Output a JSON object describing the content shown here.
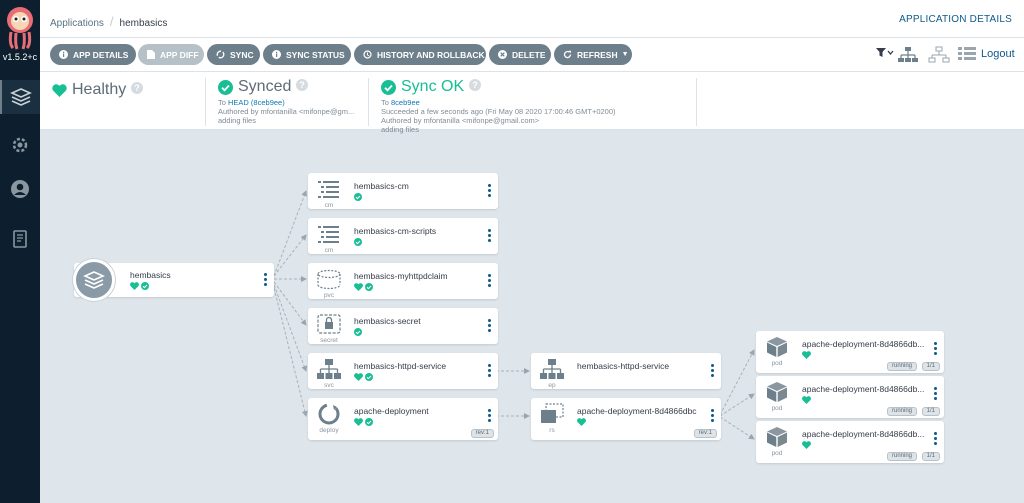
{
  "app": {
    "version": "v1.5.2+c"
  },
  "breadcrumb": {
    "parent": "Applications",
    "current": "hembasics"
  },
  "header": {
    "details_link": "APPLICATION DETAILS"
  },
  "toolbar": {
    "app_details": "APP DETAILS",
    "app_diff": "APP DIFF",
    "sync": "SYNC",
    "sync_status": "SYNC STATUS",
    "history": "HISTORY AND ROLLBACK",
    "delete": "DELETE",
    "refresh": "REFRESH",
    "logout": "Logout"
  },
  "status": {
    "health": {
      "label": "Healthy"
    },
    "sync": {
      "label": "Synced",
      "to_prefix": "To",
      "to": "HEAD (8ceb9ee)",
      "author": "Authored by mfontanilla <mifonpe@gm...",
      "message": "adding files"
    },
    "operation": {
      "label": "Sync OK",
      "to_prefix": "To",
      "to": "8ceb9ee",
      "succeeded": "Succeeded a few seconds ago (Fri May 08 2020 17:00:46 GMT+0200)",
      "author": "Authored by mfontanilla <mifonpe@gmail.com>",
      "message": "adding files"
    }
  },
  "colors": {
    "healthy": "#18be94",
    "accent": "#0e5a8a",
    "button": "#6d7f8b"
  },
  "graph": {
    "root": {
      "name": "hembasics"
    },
    "nodes": [
      {
        "name": "hembasics-cm",
        "kind": "cm"
      },
      {
        "name": "hembasics-cm-scripts",
        "kind": "cm"
      },
      {
        "name": "hembasics-myhttpdclaim",
        "kind": "pvc"
      },
      {
        "name": "hembasics-secret",
        "kind": "secret"
      },
      {
        "name": "hembasics-httpd-service",
        "kind": "svc"
      },
      {
        "name": "apache-deployment",
        "kind": "deploy",
        "tag": "rev:1"
      },
      {
        "name": "hembasics-httpd-service",
        "kind": "ep"
      },
      {
        "name": "apache-deployment-8d4866dbc",
        "kind": "rs",
        "tag": "rev:1"
      },
      {
        "name": "apache-deployment-8d4866db...",
        "kind": "pod",
        "tag1": "running",
        "tag2": "1/1"
      },
      {
        "name": "apache-deployment-8d4866db...",
        "kind": "pod",
        "tag1": "running",
        "tag2": "1/1"
      },
      {
        "name": "apache-deployment-8d4866db...",
        "kind": "pod",
        "tag1": "running",
        "tag2": "1/1"
      }
    ]
  }
}
